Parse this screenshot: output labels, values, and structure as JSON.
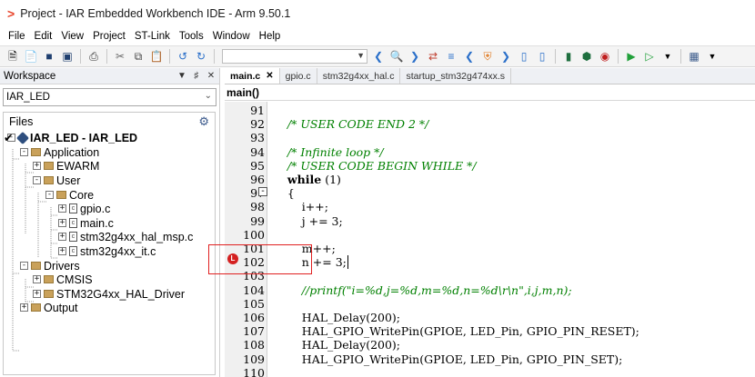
{
  "title_bar": {
    "logo": ">",
    "title": "Project - IAR Embedded Workbench IDE - Arm 9.50.1"
  },
  "menu": [
    "File",
    "Edit",
    "View",
    "Project",
    "ST-Link",
    "Tools",
    "Window",
    "Help"
  ],
  "workspace": {
    "header": "Workspace",
    "pin_icon": "pin-icon",
    "close_icon": "close-icon",
    "config_select": "IAR_LED",
    "files_label": "Files",
    "tree": [
      {
        "label": "IAR_LED - IAR_LED",
        "kind": "project",
        "checked": true
      },
      {
        "label": "Application",
        "kind": "folder"
      },
      {
        "label": "EWARM",
        "kind": "folder"
      },
      {
        "label": "User",
        "kind": "folder"
      },
      {
        "label": "Core",
        "kind": "folder"
      },
      {
        "label": "gpio.c",
        "kind": "file"
      },
      {
        "label": "main.c",
        "kind": "file"
      },
      {
        "label": "stm32g4xx_hal_msp.c",
        "kind": "file"
      },
      {
        "label": "stm32g4xx_it.c",
        "kind": "file"
      },
      {
        "label": "Drivers",
        "kind": "folder"
      },
      {
        "label": "CMSIS",
        "kind": "folder"
      },
      {
        "label": "STM32G4xx_HAL_Driver",
        "kind": "folder"
      },
      {
        "label": "Output",
        "kind": "folder"
      }
    ]
  },
  "editor": {
    "tabs": [
      {
        "label": "main.c",
        "active": true
      },
      {
        "label": "gpio.c",
        "active": false
      },
      {
        "label": "stm32g4xx_hal.c",
        "active": false
      },
      {
        "label": "startup_stm32g474xx.s",
        "active": false
      }
    ],
    "function_bar": "main()",
    "lines": [
      {
        "n": "91",
        "text": ""
      },
      {
        "n": "92",
        "text": "    /* USER CODE END 2 */"
      },
      {
        "n": "93",
        "text": ""
      },
      {
        "n": "94",
        "text": "    /* Infinite loop */"
      },
      {
        "n": "95",
        "text": "    /* USER CODE BEGIN WHILE */"
      },
      {
        "n": "96",
        "text": "    while (1)"
      },
      {
        "n": "97",
        "text": "    {"
      },
      {
        "n": "98",
        "text": "        i++;"
      },
      {
        "n": "99",
        "text": "        j += 3;"
      },
      {
        "n": "100",
        "text": ""
      },
      {
        "n": "101",
        "text": "        m++;"
      },
      {
        "n": "102",
        "text": "        n += 3;"
      },
      {
        "n": "103",
        "text": ""
      },
      {
        "n": "104",
        "text": "        //printf(\"i=%d,j=%d,m=%d,n=%d\\r\\n\",i,j,m,n);"
      },
      {
        "n": "105",
        "text": ""
      },
      {
        "n": "106",
        "text": "        HAL_Delay(200);"
      },
      {
        "n": "107",
        "text": "        HAL_GPIO_WritePin(GPIOE, LED_Pin, GPIO_PIN_RESET);"
      },
      {
        "n": "108",
        "text": "        HAL_Delay(200);"
      },
      {
        "n": "109",
        "text": "        HAL_GPIO_WritePin(GPIOE, LED_Pin, GPIO_PIN_SET);"
      },
      {
        "n": "110",
        "text": ""
      }
    ],
    "breakpoint_line": "102",
    "breakpoint_marker": "L"
  },
  "colors": {
    "comment": "#008000",
    "breakpoint": "#d42020",
    "highlight": "#e02020",
    "folder": "#c9a15a",
    "logo": "#e8452c"
  }
}
